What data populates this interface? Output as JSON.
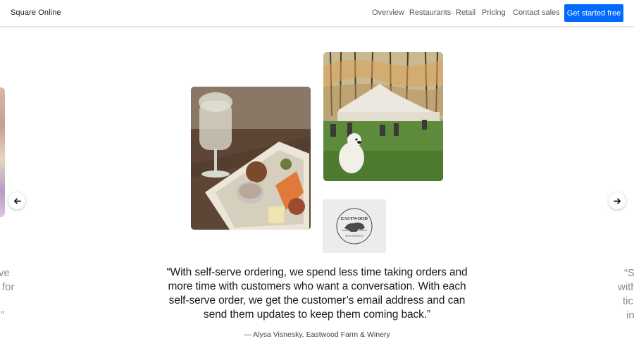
{
  "header": {
    "brand": "Square Online",
    "nav": [
      "Overview",
      "Restaurants",
      "Retail",
      "Pricing",
      "Contact sales"
    ],
    "cta": "Get started free"
  },
  "carousel": {
    "prev_icon": "arrow-left-icon",
    "next_icon": "arrow-right-icon",
    "left_slide_text": [
      "ve",
      "for",
      ".”"
    ],
    "right_slide_text": [
      "“S",
      "with",
      "tic",
      "in"
    ],
    "logo_text_top": "EASTWOOD",
    "logo_text_bottom": "Farm and Winery",
    "quote": "“With self-serve ordering, we spend less time taking orders and more time with customers who want a conversation. With each self-serve order, we get the customer’s email address and can send them updates to keep them coming back.”",
    "attribution": "— Alysa Visnesky, Eastwood Farm & Winery"
  },
  "colors": {
    "accent": "#006aff",
    "text": "#1a1a1a",
    "muted": "#8a8a8a"
  }
}
